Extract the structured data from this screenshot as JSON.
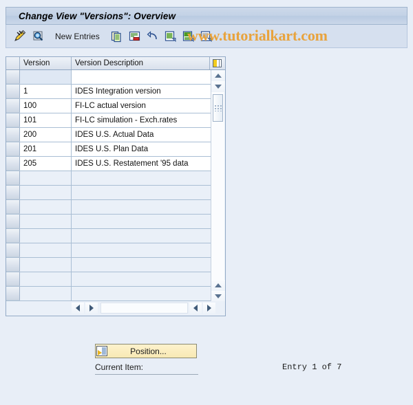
{
  "window": {
    "title": "Change View \"Versions\": Overview"
  },
  "watermark": {
    "text": "www.tutorialkart.com",
    "color": "#e8a33d"
  },
  "toolbar": {
    "new_entries_label": "New Entries",
    "buttons": [
      {
        "name": "display-change-icon",
        "title": "Display/Change"
      },
      {
        "name": "details-magnifier-icon",
        "title": "Details"
      },
      {
        "name": "copy-as-icon",
        "title": "Copy As..."
      },
      {
        "name": "delete-row-icon",
        "title": "Delete"
      },
      {
        "name": "undo-icon",
        "title": "Undo Change"
      },
      {
        "name": "select-all-icon",
        "title": "Select All"
      },
      {
        "name": "select-block-icon",
        "title": "Select Block"
      },
      {
        "name": "deselect-all-icon",
        "title": "Deselect All"
      }
    ]
  },
  "table": {
    "columns": [
      "Version",
      "Version Description"
    ],
    "config_icon": "table-settings-icon",
    "input_row": {
      "version": "",
      "description": ""
    },
    "rows": [
      {
        "version": "1",
        "description": "IDES Integration version"
      },
      {
        "version": "100",
        "description": "FI-LC actual version"
      },
      {
        "version": "101",
        "description": "FI-LC simulation - Exch.rates"
      },
      {
        "version": "200",
        "description": "IDES U.S. Actual Data"
      },
      {
        "version": "201",
        "description": "IDES U.S. Plan Data"
      },
      {
        "version": "205",
        "description": "IDES U.S. Restatement '95 data"
      }
    ],
    "empty_row_count": 10
  },
  "footer": {
    "position_button_label": "Position...",
    "current_item_label": "Current Item:",
    "entry_status": "Entry 1 of 7"
  }
}
